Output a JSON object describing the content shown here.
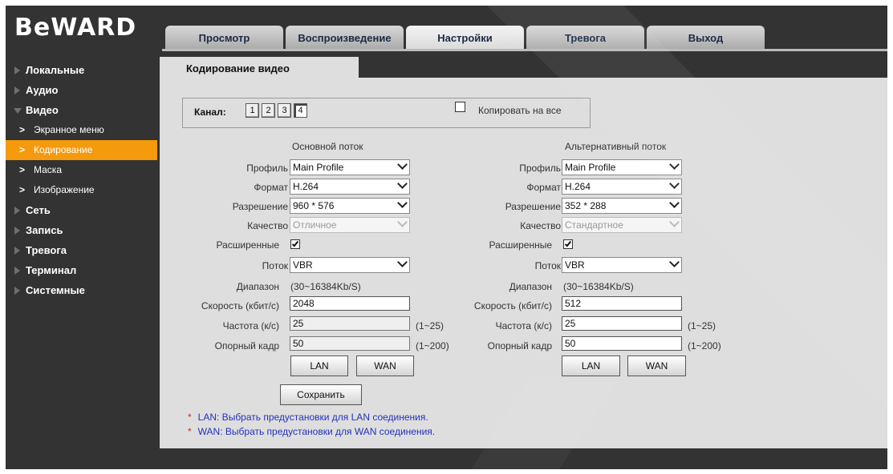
{
  "brand": "BeWARD",
  "tabs": [
    "Просмотр",
    "Воспроизведение",
    "Настройки",
    "Тревога",
    "Выход"
  ],
  "active_tab": "Настройки",
  "sidebar": {
    "items": [
      {
        "label": "Локальные"
      },
      {
        "label": "Аудио"
      },
      {
        "label": "Видео",
        "expanded": true
      },
      {
        "label": "Экранное меню"
      },
      {
        "label": "Кодирование",
        "active": true
      },
      {
        "label": "Маска"
      },
      {
        "label": "Изображение"
      },
      {
        "label": "Сеть"
      },
      {
        "label": "Запись"
      },
      {
        "label": "Тревога"
      },
      {
        "label": "Терминал"
      },
      {
        "label": "Системные"
      }
    ]
  },
  "page_title": "Кодирование видео",
  "channel": {
    "label": "Канал:",
    "buttons": [
      "1",
      "2",
      "3",
      "4"
    ],
    "selected": "4",
    "copy_all_label": "Копировать на все",
    "copy_all_checked": false
  },
  "labels": {
    "profile": "Профиль",
    "format": "Формат",
    "resolution": "Разрешение",
    "quality": "Качество",
    "advanced": "Расширенные",
    "stream": "Поток",
    "range": "Диапазон",
    "bitrate": "Скорость (кбит/с)",
    "framerate": "Частота (к/с)",
    "keyframe": "Опорный кадр"
  },
  "main_stream": {
    "title": "Основной поток",
    "profile": "Main Profile",
    "format": "H.264",
    "resolution": "960 * 576",
    "quality": "Отличное",
    "advanced": true,
    "stream": "VBR",
    "range": "(30~16384Kb/S)",
    "bitrate": "2048",
    "framerate": "25",
    "framerate_range": "(1~25)",
    "keyframe": "50",
    "keyframe_range": "(1~200)"
  },
  "sub_stream": {
    "title": "Альтернативный поток",
    "profile": "Main Profile",
    "format": "H.264",
    "resolution": "352 * 288",
    "quality": "Стандартное",
    "advanced": true,
    "stream": "VBR",
    "range": "(30~16384Kb/S)",
    "bitrate": "512",
    "framerate": "25",
    "framerate_range": "(1~25)",
    "keyframe": "50",
    "keyframe_range": "(1~200)"
  },
  "buttons": {
    "lan": "LAN",
    "wan": "WAN",
    "save": "Сохранить"
  },
  "notes": [
    "LAN: Выбрать предустановки для LAN соединения.",
    "WAN: Выбрать предустановки для WAN соединения."
  ],
  "note_marker": "*",
  "colors": {
    "background": "#333333",
    "panel": "#dedede",
    "accent": "#f59a0c",
    "note": "#2233bb"
  }
}
